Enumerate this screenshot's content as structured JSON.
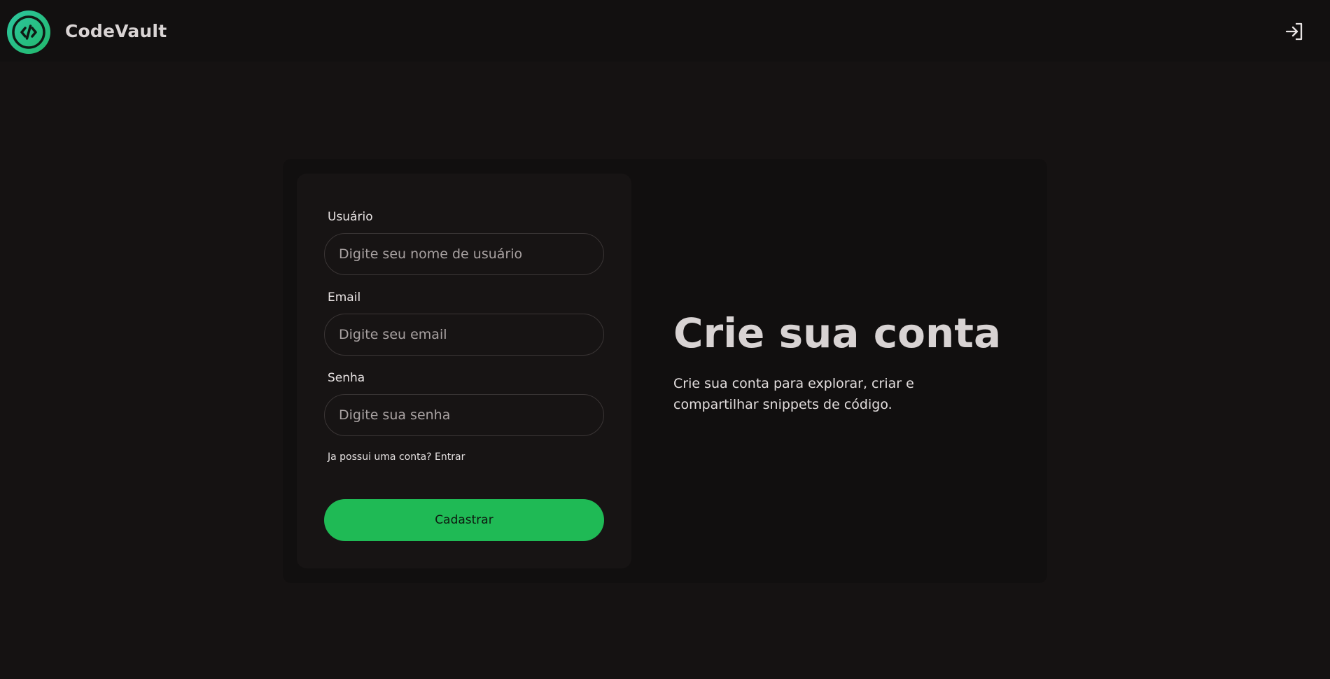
{
  "header": {
    "app_title": "CodeVault",
    "logo_icon": "code-brackets-icon",
    "login_icon": "sign-in-icon"
  },
  "form": {
    "username": {
      "label": "Usuário",
      "placeholder": "Digite seu nome de usuário",
      "value": ""
    },
    "email": {
      "label": "Email",
      "placeholder": "Digite seu email",
      "value": ""
    },
    "password": {
      "label": "Senha",
      "placeholder": "Digite sua senha",
      "value": ""
    },
    "login_link": "Ja possui uma conta? Entrar",
    "submit_label": "Cadastrar"
  },
  "hero": {
    "title": "Crie sua conta",
    "description": "Crie sua conta para explorar, criar e compartilhar snippets de código."
  },
  "colors": {
    "background": "#151212",
    "accent": "#1fba55",
    "logo_gradient_start": "#2dc6a0",
    "logo_gradient_end": "#22b86a"
  }
}
